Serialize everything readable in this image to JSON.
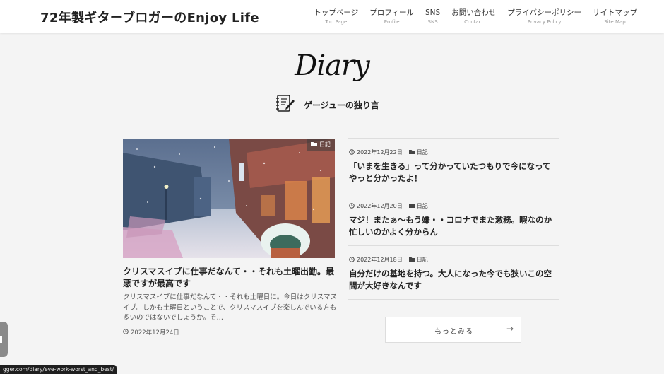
{
  "header": {
    "site_title": "72年製ギターブロガーのEnjoy Life",
    "nav": [
      {
        "ja": "トップページ",
        "en": "Top Page"
      },
      {
        "ja": "プロフィール",
        "en": "Profile"
      },
      {
        "ja": "SNS",
        "en": "SNS"
      },
      {
        "ja": "お問い合わせ",
        "en": "Contact"
      },
      {
        "ja": "プライバシーポリシー",
        "en": "Privacy Policy"
      },
      {
        "ja": "サイトマップ",
        "en": "Site Map"
      }
    ]
  },
  "section": {
    "script_title": "Diary",
    "subtitle": "ゲージューの独り言",
    "icon": "notebook-pen-icon"
  },
  "featured": {
    "category": "日記",
    "title": "クリスマスイブに仕事だなんて・・それも土曜出勤。最悪ですが最高です",
    "excerpt": "クリスマスイブに仕事だなんて・・それも土曜日に。今日はクリスマスイブ。しかも土曜日ということで、クリスマスイブを楽しんでいる方も多いのではないでしょうか。そ…",
    "date": "2022年12月24日"
  },
  "posts": [
    {
      "date": "2022年12月22日",
      "category": "日記",
      "title": "「いまを生きる」って分かっていたつもりで今になってやっと分かったよ！"
    },
    {
      "date": "2022年12月20日",
      "category": "日記",
      "title": "マジ！またぁ〜もう嫌・・コロナでまた激務。暇なのか忙しいのかよく分からん"
    },
    {
      "date": "2022年12月18日",
      "category": "日記",
      "title": "自分だけの基地を持つ。大人になった今でも狭いこの空間が大好きなんです"
    }
  ],
  "more_button": {
    "label": "もっとみる",
    "arrow": "→"
  },
  "status_bar": {
    "url": "gger.com/diary/eve-work-worst_and_best/"
  }
}
